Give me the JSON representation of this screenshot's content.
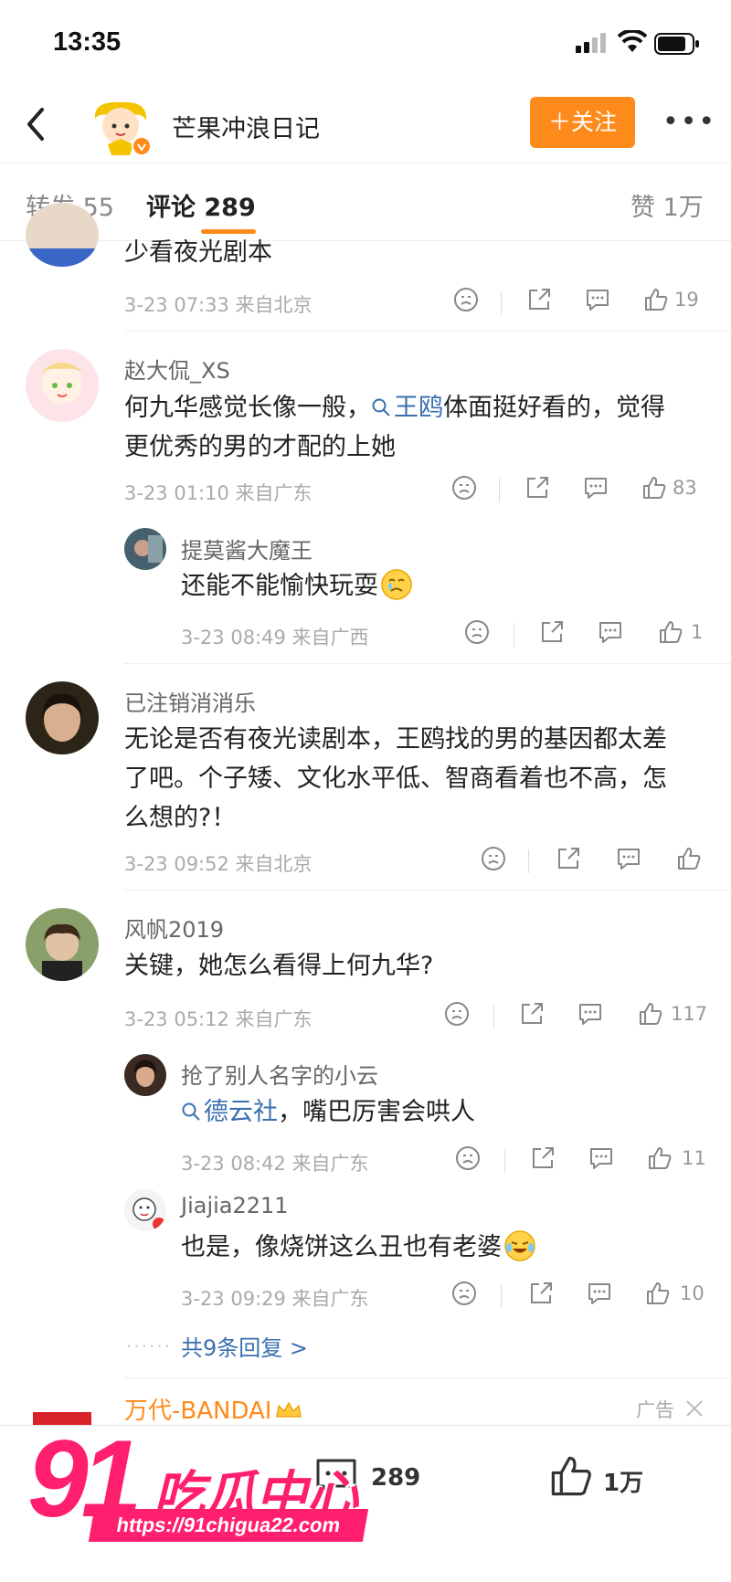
{
  "status_bar": {
    "time": "13:35"
  },
  "header": {
    "title": "芒果冲浪日记",
    "follow_label": "＋关注"
  },
  "tabs": [
    {
      "label": "转发 55"
    },
    {
      "label": "评论 289"
    },
    {
      "label": "赞 1万"
    }
  ],
  "comments": [
    {
      "text": "少看夜光剧本",
      "meta": "3-23 07:33 来自北京",
      "likes": "19"
    },
    {
      "user": "赵大侃_XS",
      "text_pre": "何九华感觉长像一般，",
      "link": "王鸥",
      "text_post": "体面挺好看的，觉得",
      "text_line2": "更优秀的男的才配的上她",
      "meta": "3-23 01:10 来自广东",
      "likes": "83",
      "reply": {
        "user": "提莫酱大魔王",
        "text": "还能不能愉快玩耍",
        "meta": "3-23 08:49 来自广西",
        "likes": "1"
      }
    },
    {
      "user": "已注销消消乐",
      "line1": "无论是否有夜光读剧本，王鸥找的男的基因都太差",
      "line2": "了吧。个子矮、文化水平低、智商看着也不高，怎",
      "line3": "么想的?！",
      "meta": "3-23 09:52 来自北京"
    },
    {
      "user": "风帆2019",
      "text": "关键，她怎么看得上何九华?",
      "meta": "3-23 05:12 来自广东",
      "likes": "117",
      "replies": [
        {
          "user": "抢了别人名字的小云",
          "link": "德云社",
          "text": "，嘴巴厉害会哄人",
          "meta": "3-23 08:42 来自广东",
          "likes": "11"
        },
        {
          "user": "Jiajia2211",
          "text": "也是，像烧饼这么丑也有老婆",
          "meta": "3-23 09:29 来自广东",
          "likes": "10"
        }
      ],
      "more_replies": "共9条回复 >"
    }
  ],
  "ad": {
    "name": "万代-BANDAI",
    "tag": "广告"
  },
  "bottom_bar": {
    "comments_count": "289",
    "likes_count": "1万"
  },
  "watermark": {
    "big": "91",
    "text": "吃瓜中心",
    "url": "https://91chigua22.com"
  },
  "colors": {
    "accent": "#ff8a1c",
    "link": "#3a6fb0",
    "watermark": "#ff1f6e"
  }
}
